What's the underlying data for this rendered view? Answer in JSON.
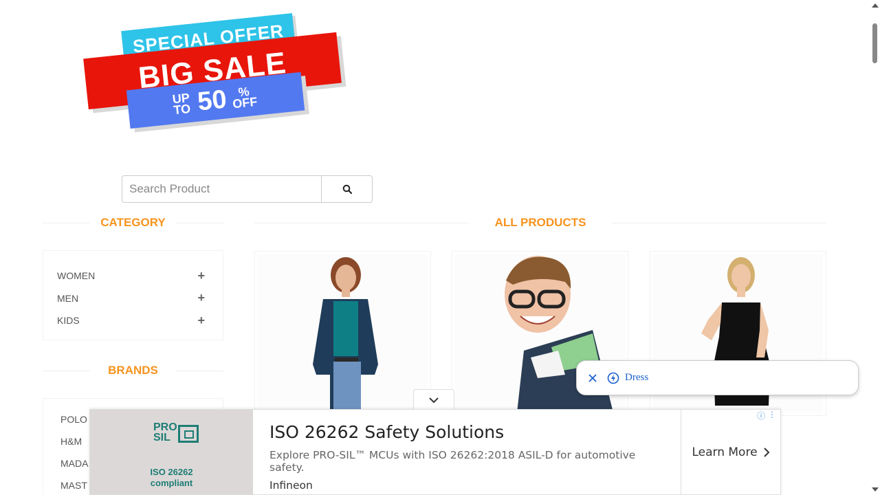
{
  "banner": {
    "line1": "SPECIAL OFFER",
    "line2": "BIG SALE",
    "up_to": "UP TO",
    "percent": "50",
    "pct_off": "% OFF"
  },
  "search": {
    "placeholder": "Search Product",
    "value": ""
  },
  "category": {
    "title": "CATEGORY",
    "items": [
      {
        "label": "WOMEN",
        "toggle": "+"
      },
      {
        "label": "MEN",
        "toggle": "+"
      },
      {
        "label": "KIDS",
        "toggle": "+"
      }
    ]
  },
  "brands": {
    "title": "BRANDS",
    "items": [
      "POLO",
      "H&M",
      "MADA",
      "MAST"
    ]
  },
  "products": {
    "title": "ALL PRODUCTS"
  },
  "chip": {
    "label": "Dress"
  },
  "ad": {
    "logo_top": "PRO SIL",
    "logo_caption_1": "ISO 26262",
    "logo_caption_2": "compliant",
    "headline": "ISO 26262 Safety Solutions",
    "description": "Explore PRO-SIL™ MCUs with ISO 26262:2018 ASIL-D for automotive safety.",
    "advertiser": "Infineon",
    "cta": "Learn More"
  },
  "colors": {
    "accent": "#f7931e",
    "link": "#1a5fd0",
    "brand_green": "#1e7d74"
  }
}
